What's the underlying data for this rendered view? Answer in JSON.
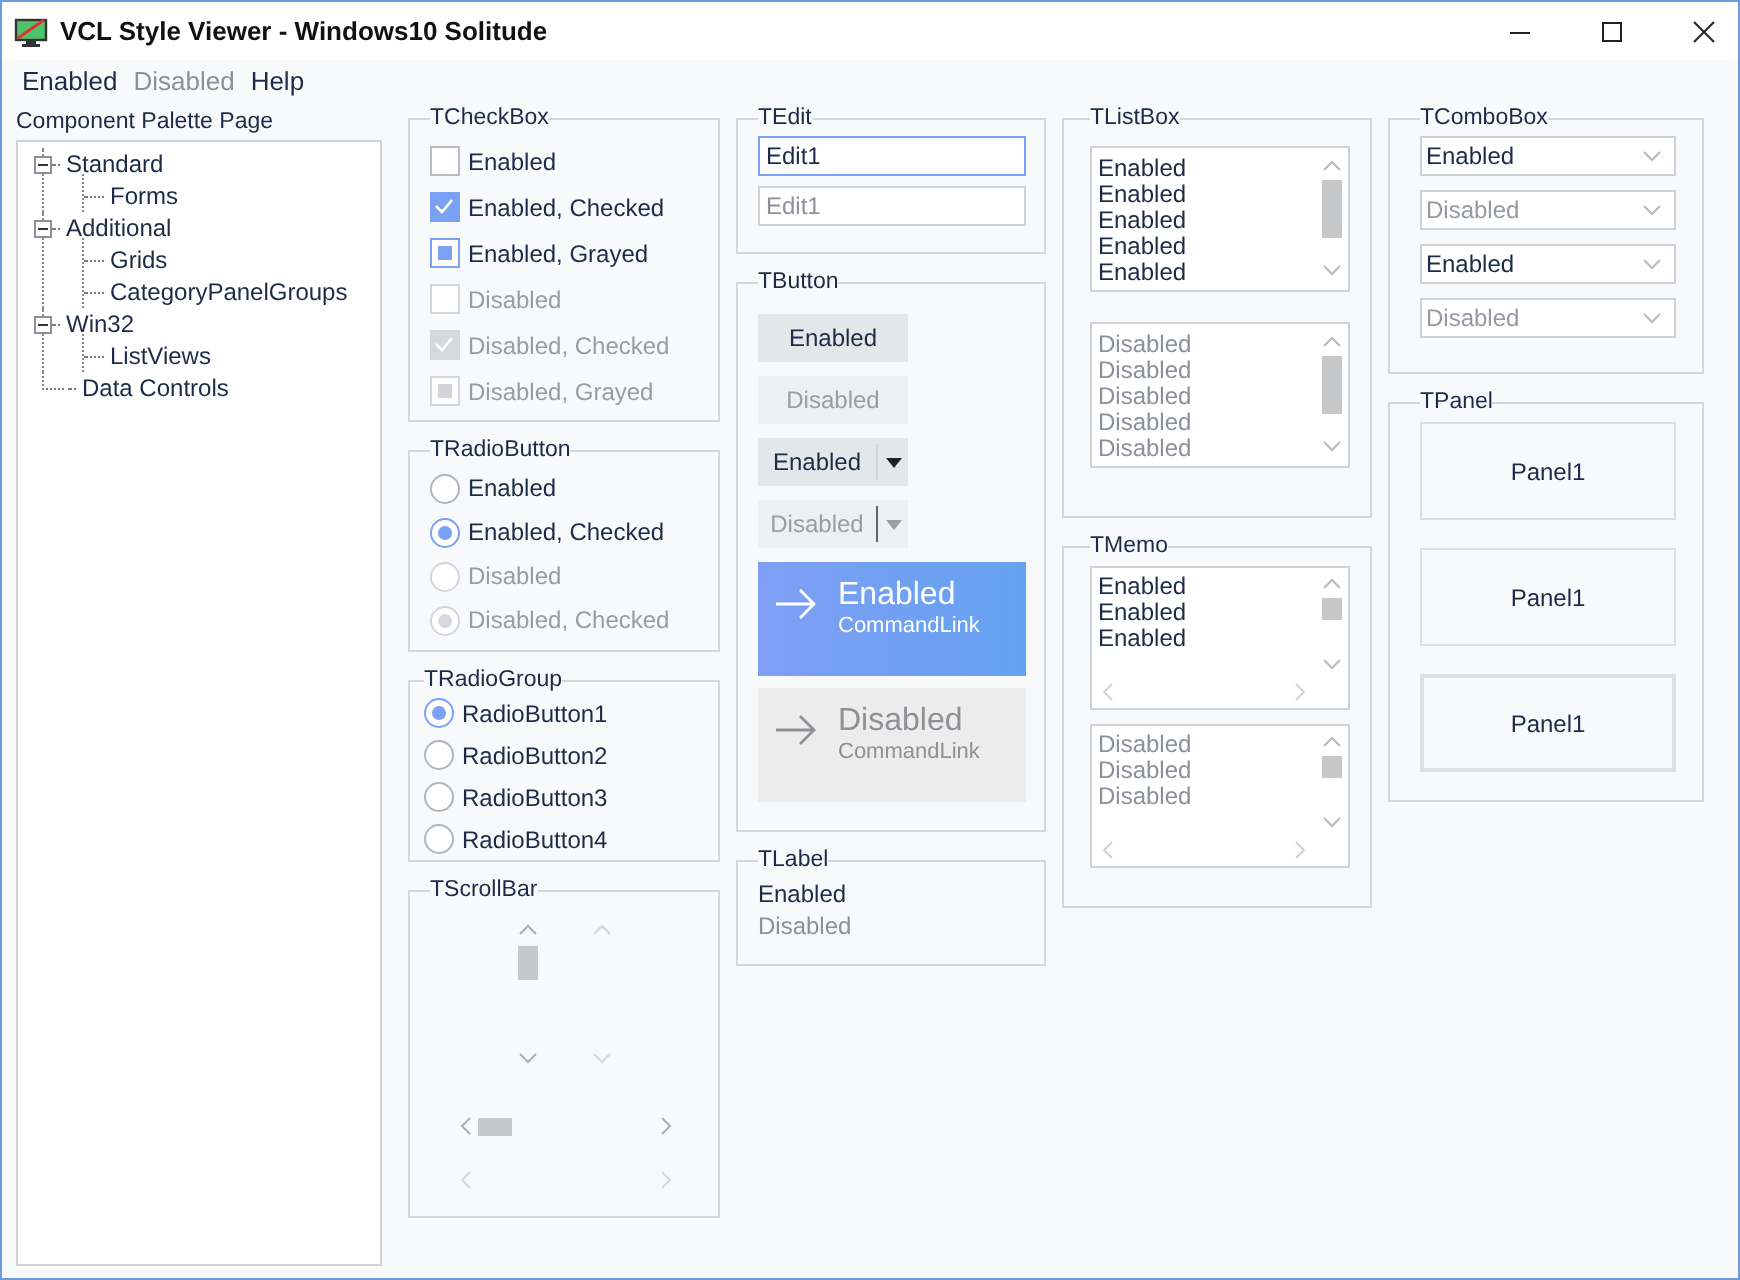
{
  "window": {
    "title": "VCL Style Viewer - Windows10 Solitude"
  },
  "menu": [
    {
      "label": "Enabled",
      "disabled": false
    },
    {
      "label": "Disabled",
      "disabled": true
    },
    {
      "label": "Help",
      "disabled": false
    }
  ],
  "palette": {
    "label": "Component Palette Page",
    "tree": [
      {
        "label": "Standard",
        "expanded": true,
        "children": [
          {
            "label": "Forms"
          }
        ]
      },
      {
        "label": "Additional",
        "expanded": true,
        "children": [
          {
            "label": "Grids"
          },
          {
            "label": "CategoryPanelGroups"
          }
        ]
      },
      {
        "label": "Win32",
        "expanded": true,
        "children": [
          {
            "label": "ListViews"
          }
        ]
      },
      {
        "label": "Data Controls"
      }
    ]
  },
  "checkboxes": {
    "title": "TCheckBox",
    "items": [
      {
        "label": "Enabled",
        "checked": false,
        "grayed": false,
        "disabled": false
      },
      {
        "label": "Enabled, Checked",
        "checked": true,
        "grayed": false,
        "disabled": false
      },
      {
        "label": "Enabled, Grayed",
        "checked": false,
        "grayed": true,
        "disabled": false
      },
      {
        "label": "Disabled",
        "checked": false,
        "grayed": false,
        "disabled": true
      },
      {
        "label": "Disabled, Checked",
        "checked": true,
        "grayed": false,
        "disabled": true
      },
      {
        "label": "Disabled, Grayed",
        "checked": false,
        "grayed": true,
        "disabled": true
      }
    ]
  },
  "radio_buttons": {
    "title": "TRadioButton",
    "items": [
      {
        "label": "Enabled",
        "selected": false,
        "disabled": false
      },
      {
        "label": "Enabled, Checked",
        "selected": true,
        "disabled": false
      },
      {
        "label": "Disabled",
        "selected": false,
        "disabled": true
      },
      {
        "label": "Disabled, Checked",
        "selected": true,
        "disabled": true
      }
    ]
  },
  "radio_group": {
    "title": "TRadioGroup",
    "items": [
      {
        "label": "RadioButton1",
        "selected": true
      },
      {
        "label": "RadioButton2",
        "selected": false
      },
      {
        "label": "RadioButton3",
        "selected": false
      },
      {
        "label": "RadioButton4",
        "selected": false
      }
    ]
  },
  "scrollbars": {
    "title": "TScrollBar",
    "bars": [
      {
        "kind": "vertical",
        "disabled": false
      },
      {
        "kind": "vertical",
        "disabled": true
      },
      {
        "kind": "horizontal",
        "disabled": false
      },
      {
        "kind": "horizontal",
        "disabled": true
      }
    ]
  },
  "edit": {
    "title": "TEdit",
    "fields": [
      {
        "value": "Edit1",
        "focused": true,
        "disabled": false
      },
      {
        "value": "Edit1",
        "focused": false,
        "disabled": true
      }
    ]
  },
  "buttons": {
    "title": "TButton",
    "items": [
      {
        "kind": "push",
        "label": "Enabled",
        "disabled": false
      },
      {
        "kind": "push",
        "label": "Disabled",
        "disabled": true
      },
      {
        "kind": "split",
        "label": "Enabled",
        "disabled": false
      },
      {
        "kind": "split",
        "label": "Disabled",
        "disabled": true
      },
      {
        "kind": "command",
        "label": "Enabled",
        "note": "CommandLink",
        "disabled": false
      },
      {
        "kind": "command",
        "label": "Disabled",
        "note": "CommandLink",
        "disabled": true
      }
    ]
  },
  "label": {
    "title": "TLabel",
    "items": [
      {
        "text": "Enabled",
        "disabled": false
      },
      {
        "text": "Disabled",
        "disabled": true
      }
    ]
  },
  "listbox": {
    "title": "TListBox",
    "lists": [
      {
        "disabled": false,
        "items": [
          "Enabled",
          "Enabled",
          "Enabled",
          "Enabled",
          "Enabled"
        ]
      },
      {
        "disabled": true,
        "items": [
          "Disabled",
          "Disabled",
          "Disabled",
          "Disabled",
          "Disabled"
        ]
      }
    ]
  },
  "memo": {
    "title": "TMemo",
    "memos": [
      {
        "disabled": false,
        "lines": [
          "Enabled",
          "Enabled",
          "Enabled"
        ]
      },
      {
        "disabled": true,
        "lines": [
          "Disabled",
          "Disabled",
          "Disabled"
        ]
      }
    ]
  },
  "combobox": {
    "title": "TComboBox",
    "items": [
      {
        "value": "Enabled",
        "disabled": false
      },
      {
        "value": "Disabled",
        "disabled": true
      },
      {
        "value": "Enabled",
        "disabled": false
      },
      {
        "value": "Disabled",
        "disabled": true
      }
    ]
  },
  "panel": {
    "title": "TPanel",
    "items": [
      {
        "caption": "Panel1",
        "kind": "flat"
      },
      {
        "caption": "Panel1",
        "kind": "flat"
      },
      {
        "caption": "Panel1",
        "kind": "bevel"
      }
    ]
  }
}
